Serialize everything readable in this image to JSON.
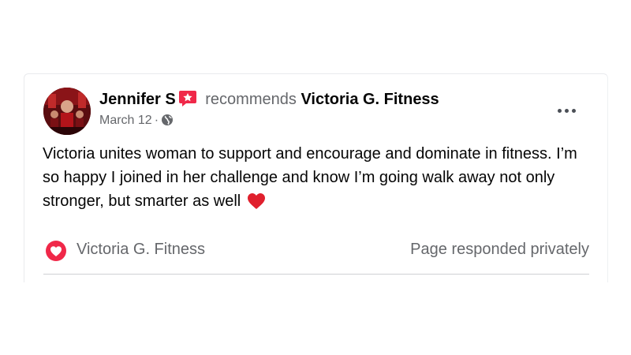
{
  "post": {
    "author": "Jennifer S",
    "verb": "recommends",
    "page": "Victoria G. Fitness",
    "date": "March 12",
    "date_sep": "·",
    "body": "Victoria unites woman to support and encourage and dominate in fitness.  I’m so happy I joined in her challenge and know I’m going walk away not only stronger, but smarter as well"
  },
  "response": {
    "page_name": "Victoria G. Fitness",
    "status": "Page responded privately"
  },
  "icons": {
    "recommend_badge": "recommend-star-icon",
    "privacy": "globe-icon",
    "menu": "more-options-icon",
    "heart": "heart-emoji-icon",
    "response": "heart-circle-icon"
  },
  "colors": {
    "accent": "#f02849",
    "muted_text": "#65676b",
    "divider": "#ced0d4"
  }
}
